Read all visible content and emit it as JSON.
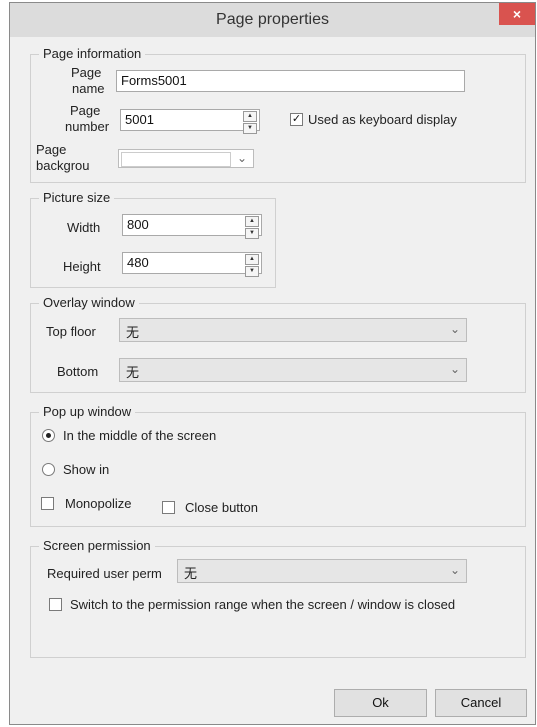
{
  "window": {
    "title": "Page properties",
    "close_glyph": "×"
  },
  "page_information": {
    "legend": "Page information",
    "name_label_1": "Page",
    "name_label_2": "name",
    "name_value": "Forms5001",
    "number_label_1": "Page",
    "number_label_2": "number",
    "number_value": "5001",
    "keyboard_label": "Used as keyboard display",
    "keyboard_checked": true,
    "background_label_1": "Page",
    "background_label_2": "backgrou",
    "background_color": "#ffffff"
  },
  "picture_size": {
    "legend": "Picture size",
    "width_label": "Width",
    "width_value": "800",
    "height_label": "Height",
    "height_value": "480"
  },
  "overlay_window": {
    "legend": "Overlay window",
    "top_label": "Top floor",
    "top_value": "无",
    "bottom_label": "Bottom",
    "bottom_value": "无"
  },
  "popup_window": {
    "legend": "Pop up window",
    "middle_label": "In the middle of the screen",
    "middle_selected": true,
    "show_in_label": "Show in",
    "monopolize_label": "Monopolize",
    "close_button_label": "Close button"
  },
  "screen_permission": {
    "legend": "Screen permission",
    "user_perm_label": "Required user perm",
    "user_perm_value": "无",
    "switch_label": "Switch to the permission range when the screen / window is closed"
  },
  "footer": {
    "ok_label": "Ok",
    "cancel_label": "Cancel"
  },
  "colors": {
    "close_button": "#d9534f",
    "window_bg": "#f0f0f0",
    "titlebar_bg": "#dcdcdc"
  }
}
